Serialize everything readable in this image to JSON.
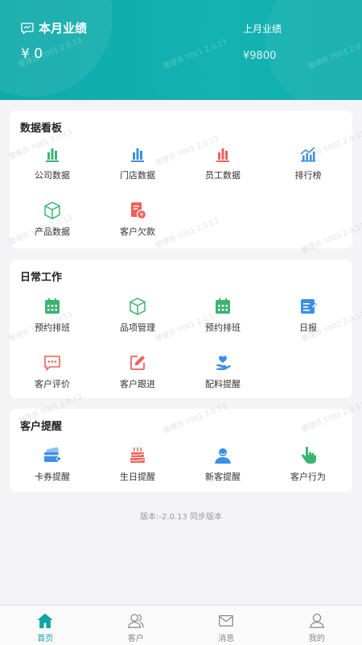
{
  "header": {
    "this_month_label": "本月业绩",
    "this_month_value": "¥ 0",
    "last_month_label": "上月业绩",
    "last_month_value": "¥9800"
  },
  "dashboard": {
    "title": "数据看板",
    "items": [
      {
        "label": "公司数据",
        "icon": "bar-chart-green-icon"
      },
      {
        "label": "门店数据",
        "icon": "bar-chart-blue-icon"
      },
      {
        "label": "员工数据",
        "icon": "bar-chart-red-icon"
      },
      {
        "label": "排行榜",
        "icon": "trend-chart-icon"
      },
      {
        "label": "产品数据",
        "icon": "box-icon"
      },
      {
        "label": "客户欠款",
        "icon": "debt-document-icon"
      }
    ]
  },
  "daily_work": {
    "title": "日常工作",
    "items": [
      {
        "label": "预约排班",
        "icon": "calendar-icon"
      },
      {
        "label": "品项管理",
        "icon": "box-icon"
      },
      {
        "label": "预约排班",
        "icon": "calendar-icon"
      },
      {
        "label": "日报",
        "icon": "report-edit-icon"
      },
      {
        "label": "客户评价",
        "icon": "comment-icon"
      },
      {
        "label": "客户跟进",
        "icon": "edit-icon"
      },
      {
        "label": "配料提醒",
        "icon": "hand-heart-icon"
      }
    ]
  },
  "reminders": {
    "title": "客户提醒",
    "items": [
      {
        "label": "卡券提醒",
        "icon": "card-icon"
      },
      {
        "label": "生日提醒",
        "icon": "cake-icon"
      },
      {
        "label": "新客提醒",
        "icon": "new-user-icon"
      },
      {
        "label": "客户行为",
        "icon": "pointer-hand-icon"
      }
    ]
  },
  "version": "版本:-2.0.13 同步版本",
  "watermark": "管理员 Y001 2.0.13",
  "tabs": [
    {
      "label": "首页",
      "icon": "home-icon",
      "active": true
    },
    {
      "label": "客户",
      "icon": "customers-icon",
      "active": false
    },
    {
      "label": "消息",
      "icon": "mail-icon",
      "active": false
    },
    {
      "label": "我的",
      "icon": "profile-icon",
      "active": false
    }
  ],
  "colors": {
    "accent": "#13a5a5",
    "green": "#3cb371",
    "blue": "#3b8fe6",
    "red": "#f0615a"
  }
}
